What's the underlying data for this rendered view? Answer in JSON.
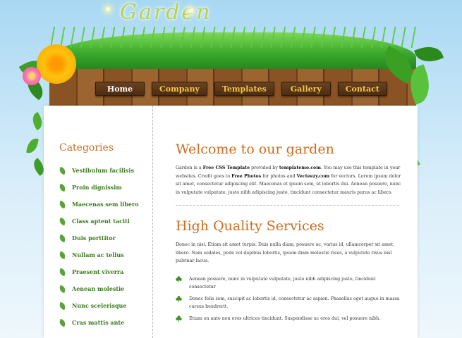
{
  "site": {
    "title": "Garden"
  },
  "nav": [
    {
      "label": "Home",
      "active": true
    },
    {
      "label": "Company",
      "active": false
    },
    {
      "label": "Templates",
      "active": false
    },
    {
      "label": "Gallery",
      "active": false
    },
    {
      "label": "Contact",
      "active": false
    }
  ],
  "sidebar": {
    "heading": "Categories",
    "items": [
      "Vestibulum facilisis",
      "Proin dignissim",
      "Maecenas sem libero",
      "Class aptent taciti",
      "Duis porttitor",
      "Nullam ac tellus",
      "Praesent viverra",
      "Aenean molestie",
      "Nunc scelerisque",
      "Cras mattis ante"
    ]
  },
  "main": {
    "welcome_heading": "Welcome to our garden",
    "welcome_text": {
      "p1": "Garden is a ",
      "b1": "Free CSS Template",
      "p2": " provided by ",
      "b2": "templatemo.com",
      "p3": ". You may use this template in your websites. Credit goes to ",
      "b3": "Free Photos",
      "p4": " for photos and ",
      "b4": "Vecteezy.com",
      "p5": " for vectors. Lorem ipsum dolor sit amet, consectetur adipiscing elit. Maecenas et ipsum sem, ut lobortis dui. Aenean posuere, nunc in vulputate vulputate, justo nibh adipiscing justo, tincidunt consectetur mauris purus ac libero."
    },
    "services_heading": "High Quality Services",
    "services_text": "Donec in nisi. Etiam sit amet turpis. Duis nulla diam, posuere ac, varius id, ullamcorper sit amet, libero. Nam sodales, pede vel dapibus lobortis, ipsum diam molestie risus, a vulputate risus nisl pulvinar lacus.",
    "bullets": [
      "Aenean posuere, nunc in vulputate vulputate, justo nibh adipiscing justo, tincidunt consectetur",
      "Donec felis sem, suscipit ac lobortis id, consectetur ac sapien. Phasellus eget augue in massa cursus hendrerit.",
      "Etiam en ante non eros ultrices tincidunt. Suspendisse ac eros dui, vel posuere nibh."
    ]
  },
  "colors": {
    "accent": "#d06b1b",
    "category_text": "#3a7b1c",
    "nav_text": "#f4c64a"
  }
}
